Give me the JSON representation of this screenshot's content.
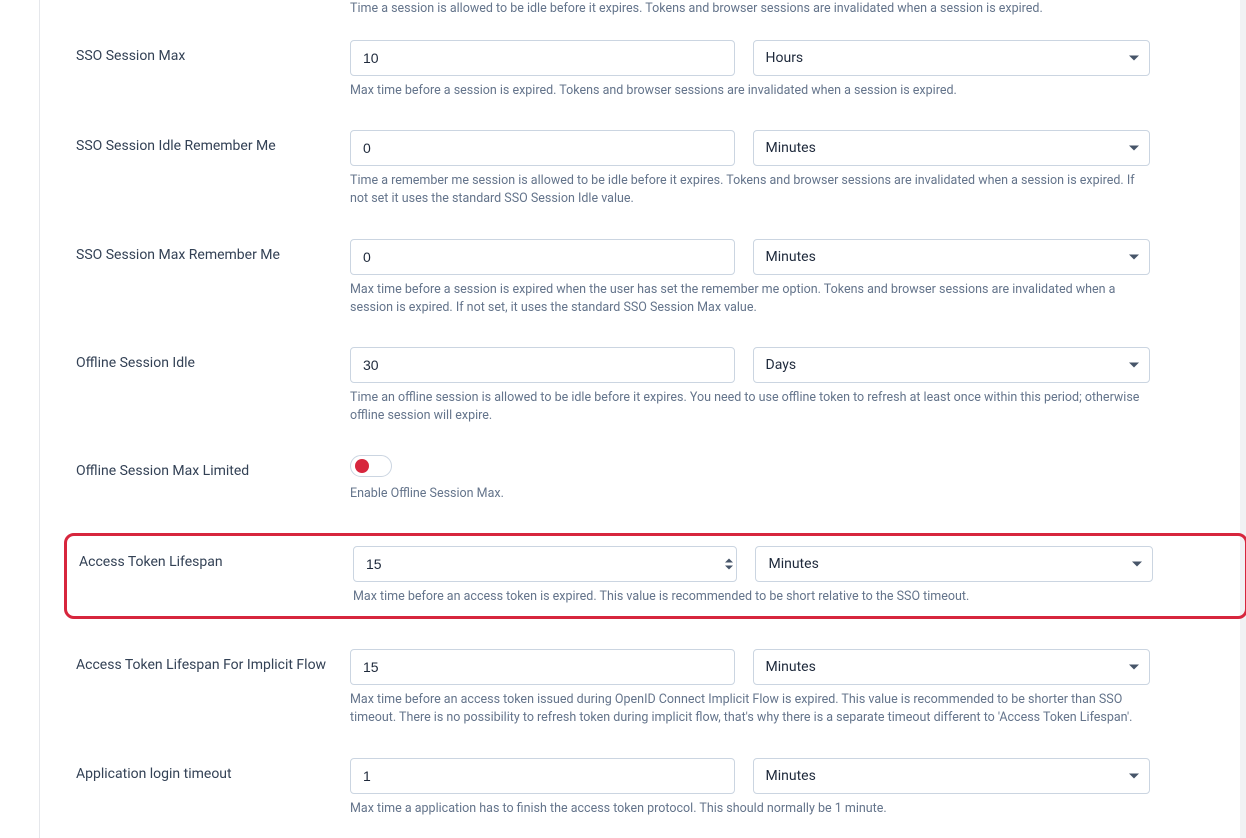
{
  "help_top": "Time a session is allowed to be idle before it expires. Tokens and browser sessions are invalidated when a session is expired.",
  "fields": {
    "ssoSessionMax": {
      "label": "SSO Session Max",
      "value": "10",
      "unit": "Hours",
      "help": "Max time before a session is expired. Tokens and browser sessions are invalidated when a session is expired."
    },
    "ssoSessionIdleRememberMe": {
      "label": "SSO Session Idle Remember Me",
      "value": "0",
      "unit": "Minutes",
      "help": "Time a remember me session is allowed to be idle before it expires. Tokens and browser sessions are invalidated when a session is expired. If not set it uses the standard SSO Session Idle value."
    },
    "ssoSessionMaxRememberMe": {
      "label": "SSO Session Max Remember Me",
      "value": "0",
      "unit": "Minutes",
      "help": "Max time before a session is expired when the user has set the remember me option. Tokens and browser sessions are invalidated when a session is expired. If not set, it uses the standard SSO Session Max value."
    },
    "offlineSessionIdle": {
      "label": "Offline Session Idle",
      "value": "30",
      "unit": "Days",
      "help": "Time an offline session is allowed to be idle before it expires. You need to use offline token to refresh at least once within this period; otherwise offline session will expire."
    },
    "offlineSessionMaxLimited": {
      "label": "Offline Session Max Limited",
      "help": "Enable Offline Session Max."
    },
    "accessTokenLifespan": {
      "label": "Access Token Lifespan",
      "value": "15",
      "unit": "Minutes",
      "help": "Max time before an access token is expired. This value is recommended to be short relative to the SSO timeout."
    },
    "accessTokenLifespanImplicit": {
      "label": "Access Token Lifespan For Implicit Flow",
      "value": "15",
      "unit": "Minutes",
      "help": "Max time before an access token issued during OpenID Connect Implicit Flow is expired. This value is recommended to be shorter than SSO timeout. There is no possibility to refresh token during implicit flow, that's why there is a separate timeout different to 'Access Token Lifespan'."
    },
    "applicationLoginTimeout": {
      "label": "Application login timeout",
      "value": "1",
      "unit": "Minutes",
      "help": "Max time a application has to finish the access token protocol. This should normally be 1 minute."
    }
  }
}
